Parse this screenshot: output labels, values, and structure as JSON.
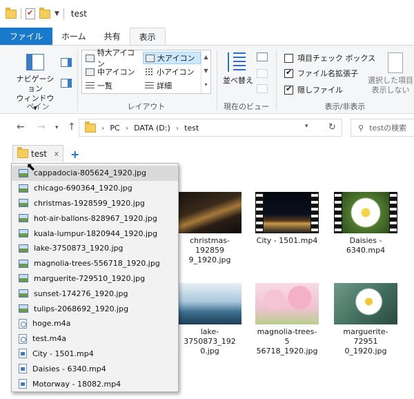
{
  "window": {
    "title": "test"
  },
  "ribbon_tabs": [
    {
      "label": "ファイル"
    },
    {
      "label": "ホーム"
    },
    {
      "label": "共有"
    },
    {
      "label": "表示"
    }
  ],
  "ribbon": {
    "pane_group": {
      "nav_pane_label": "ナビゲーション\nウィンドウ ▾",
      "label": "ペイン"
    },
    "layout_group": {
      "label": "レイアウト",
      "items": [
        {
          "label": "特大アイコン",
          "selected": false
        },
        {
          "label": "大アイコン",
          "selected": true
        },
        {
          "label": "中アイコン",
          "selected": false
        },
        {
          "label": "小アイコン",
          "selected": false
        },
        {
          "label": "一覧",
          "selected": false
        },
        {
          "label": "詳細",
          "selected": false
        }
      ]
    },
    "view_group": {
      "sort_label": "並べ替え",
      "label": "現在のビュー"
    },
    "showhide_group": {
      "label": "表示/非表示",
      "checks": [
        {
          "label": "項目チェック ボックス",
          "checked": false
        },
        {
          "label": "ファイル名拡張子",
          "checked": true
        },
        {
          "label": "隠しファイル",
          "checked": true
        }
      ],
      "hide_selected_label": "選択した項目\n表示しない"
    }
  },
  "address": {
    "segments": [
      "PC",
      "DATA (D:)",
      "test"
    ],
    "search_placeholder": "testの検索"
  },
  "folder_tab": {
    "label": "test",
    "close": "x",
    "add": "+"
  },
  "dropdown_items": [
    {
      "name": "cappadocia-805624_1920.jpg",
      "type": "image",
      "highlighted": true
    },
    {
      "name": "chicago-690364_1920.jpg",
      "type": "image"
    },
    {
      "name": "christmas-1928599_1920.jpg",
      "type": "image"
    },
    {
      "name": "hot-air-ballons-828967_1920.jpg",
      "type": "image"
    },
    {
      "name": "kuala-lumpur-1820944_1920.jpg",
      "type": "image"
    },
    {
      "name": "lake-3750873_1920.jpg",
      "type": "image"
    },
    {
      "name": "magnolia-trees-556718_1920.jpg",
      "type": "image"
    },
    {
      "name": "marguerite-729510_1920.jpg",
      "type": "image"
    },
    {
      "name": "sunset-174276_1920.jpg",
      "type": "image"
    },
    {
      "name": "tulips-2068692_1920.jpg",
      "type": "image"
    },
    {
      "name": "hoge.m4a",
      "type": "audio"
    },
    {
      "name": "test.m4a",
      "type": "audio"
    },
    {
      "name": "City - 1501.mp4",
      "type": "video"
    },
    {
      "name": "Daisies - 6340.mp4",
      "type": "video"
    },
    {
      "name": "Motorway - 18082.mp4",
      "type": "video"
    }
  ],
  "thumbnails": [
    {
      "label": "christmas-192859\n9_1920.jpg"
    },
    {
      "label": "City - 1501.mp4"
    },
    {
      "label": "Daisies -\n6340.mp4"
    },
    {
      "label": "lake-3750873_192\n0.jpg"
    },
    {
      "label": "magnolia-trees-5\n56718_1920.jpg"
    },
    {
      "label": "marguerite-72951\n0_1920.jpg"
    }
  ],
  "colors": {
    "accent": "#1979ca",
    "ribbon_bg": "#f5f6f7",
    "dropdown_bg": "#f2f2f2"
  }
}
